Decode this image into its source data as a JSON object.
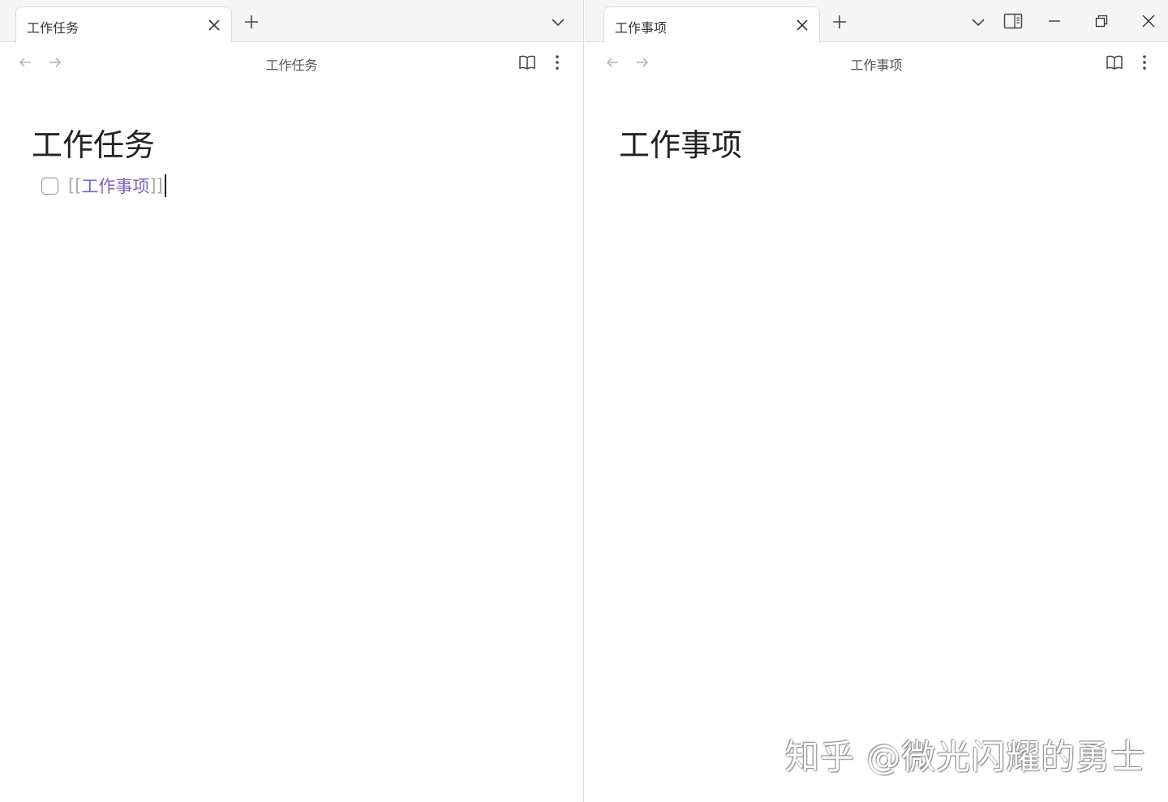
{
  "left_pane": {
    "tab": {
      "label": "工作任务"
    },
    "nav": {
      "title": "工作任务"
    },
    "page": {
      "title": "工作任务",
      "task": {
        "checked": false,
        "open_bracket": "[[",
        "link_text": "工作事项",
        "close_bracket": "]]"
      }
    }
  },
  "right_pane": {
    "tab": {
      "label": "工作事项"
    },
    "nav": {
      "title": "工作事项"
    },
    "page": {
      "title": "工作事项"
    }
  },
  "watermark": "知乎 @微光闪耀的勇士",
  "colors": {
    "link": "#7b62c9",
    "bracket": "#a8a8a8",
    "tabbar": "#f5f5f5",
    "border": "#dcdcdc"
  },
  "icons": [
    "close-icon",
    "plus-icon",
    "chevron-down-icon",
    "arrow-left-icon",
    "arrow-right-icon",
    "book-open-icon",
    "more-vertical-icon",
    "sidebar-toggle-icon",
    "minimize-icon",
    "restore-icon"
  ]
}
